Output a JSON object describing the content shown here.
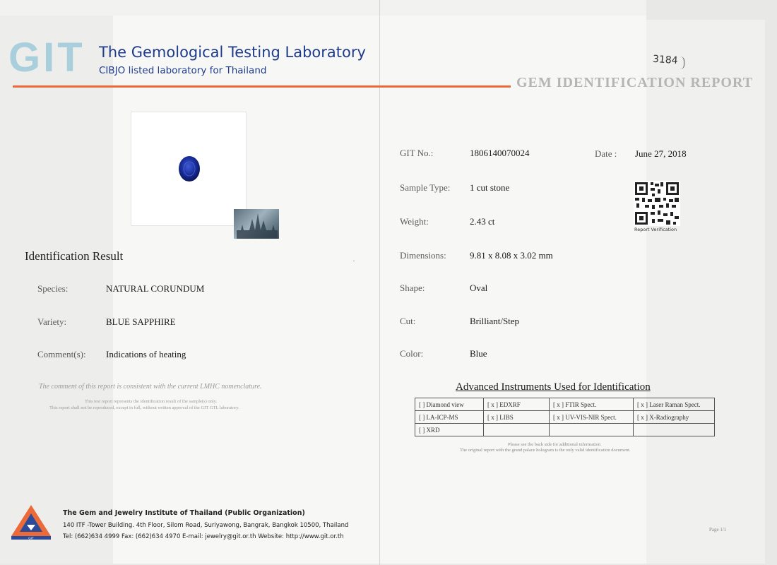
{
  "header": {
    "logo_text": "GIT",
    "lab_name": "The Gemological Testing Laboratory",
    "lab_subtitle": "CIBJO listed laboratory for Thailand",
    "report_title": "GEM IDENTIFICATION REPORT",
    "handwritten_note": "3184"
  },
  "report_info": {
    "git_no_label": "GIT No.:",
    "git_no_value": "1806140070024",
    "date_label": "Date :",
    "date_value": "June 27, 2018",
    "sample_type_label": "Sample Type:",
    "sample_type_value": "1 cut stone",
    "weight_label": "Weight:",
    "weight_value": "2.43  ct",
    "dimensions_label": "Dimensions:",
    "dimensions_value": "9.81 x 8.08 x 3.02 mm",
    "shape_label": "Shape:",
    "shape_value": "Oval",
    "cut_label": "Cut:",
    "cut_value": "Brilliant/Step",
    "color_label": "Color:",
    "color_value": "Blue",
    "qr_label": "Report Verification"
  },
  "identification": {
    "title": "Identification Result",
    "species_label": "Species:",
    "species_value": "NATURAL  CORUNDUM",
    "variety_label": "Variety:",
    "variety_value": "BLUE  SAPPHIRE",
    "comments_label": "Comment(s):",
    "comments_value": "Indications of heating",
    "comment_note": "The comment of this report is consistent with the current LMHC nomenclature.",
    "fine_print_1": "This test report represents the identification result of the sample(s) only.",
    "fine_print_2": "This report shall not be reproduced, except in full, without written approval of the GIT GTL laboratory."
  },
  "instruments": {
    "title": "Advanced Instruments Used for Identification",
    "rows": [
      [
        "[   ] Diamond view",
        "[ x ] EDXRF",
        "[ x ] FTIR Spect.",
        "[ x ] Laser Raman Spect."
      ],
      [
        "[   ] LA-ICP-MS",
        "[ x ] LIBS",
        "[ x ] UV-VIS-NIR Spect.",
        "[ x ] X-Radiography"
      ],
      [
        "[   ] XRD",
        "",
        "",
        ""
      ]
    ],
    "note_1": "Please see the back side for additional information",
    "note_2": "The original report with the grand palace hologram is the only valid identification document."
  },
  "footer": {
    "institute_name": "The Gem and Jewelry Institute of Thailand (Public Organization)",
    "address": "140 ITF -Tower Building. 4th Floor, Silom Road, Suriyawong, Bangrak, Bangkok 10500, Thailand",
    "contact": "Tel: (662)634 4999 Fax: (662)634 4970  E-mail: jewelry@git.or.th  Website: http://www.git.or.th",
    "logo_caption": "GIT",
    "page_no": "Page 1/1"
  },
  "colors": {
    "brand_blue": "#1f3c8c",
    "accent_orange": "#ec6a3a",
    "gem_blue": "#1a2f9c"
  }
}
